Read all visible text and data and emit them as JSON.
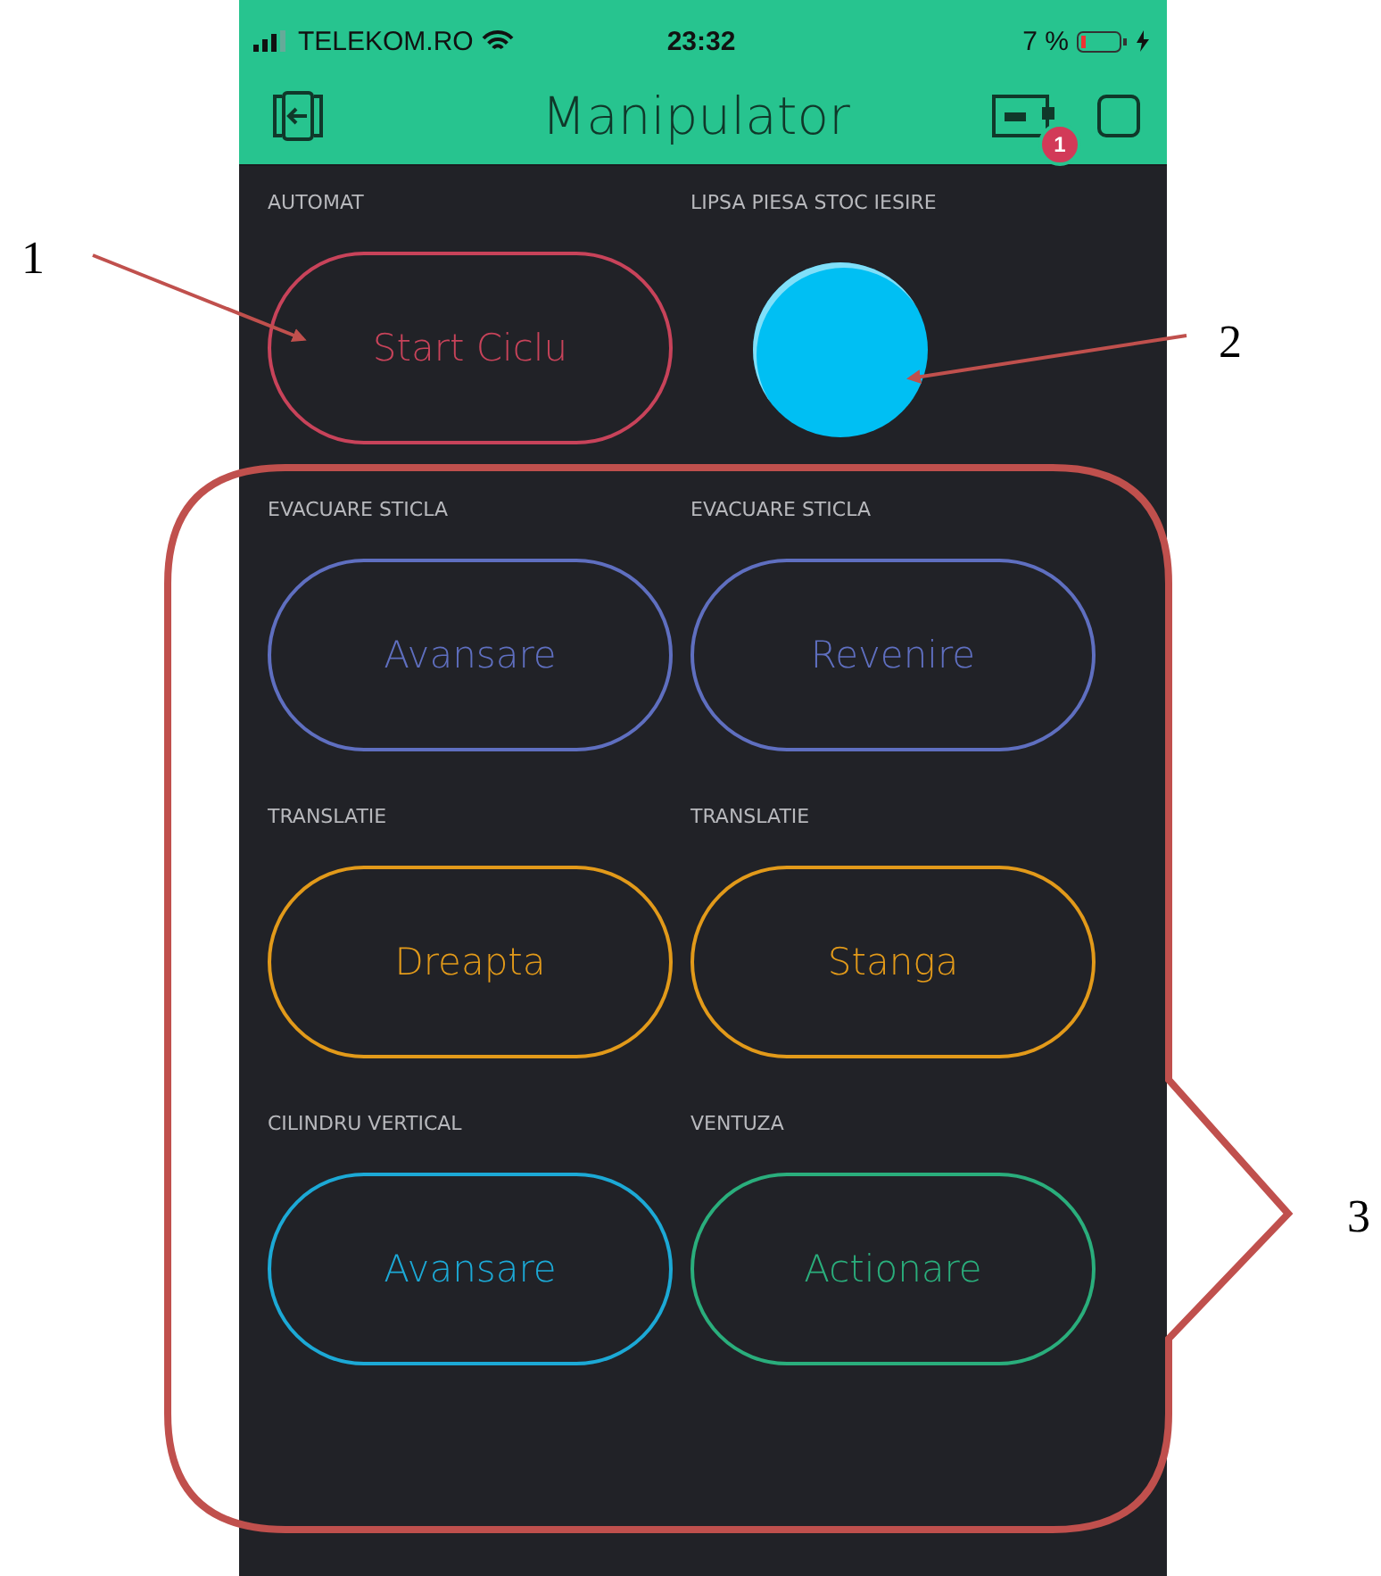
{
  "status_bar": {
    "carrier": "TELEKOM.RO",
    "time": "23:32",
    "battery": "7 %"
  },
  "header": {
    "title": "Manipulator",
    "badge": "1"
  },
  "widgets": [
    {
      "label": "AUTOMAT",
      "kind": "button",
      "text": "Start Ciclu",
      "color": "#c8435a"
    },
    {
      "label": "LIPSA PIESA STOC IESIRE",
      "kind": "led",
      "color": "#00bff3"
    },
    {
      "label": "EVACUARE STICLA",
      "kind": "button",
      "text": "Avansare",
      "color": "#5f6fc0"
    },
    {
      "label": "EVACUARE STICLA",
      "kind": "button",
      "text": "Revenire",
      "color": "#5f6fc0"
    },
    {
      "label": "TRANSLATIE",
      "kind": "button",
      "text": "Dreapta",
      "color": "#e29a1a"
    },
    {
      "label": "TRANSLATIE",
      "kind": "button",
      "text": "Stanga",
      "color": "#e29a1a"
    },
    {
      "label": "CILINDRU VERTICAL",
      "kind": "button",
      "text": "Avansare",
      "color": "#1ca9d6"
    },
    {
      "label": "VENTUZA",
      "kind": "button",
      "text": "Actionare",
      "color": "#2aae7c"
    }
  ],
  "annotations": [
    {
      "label": "1"
    },
    {
      "label": "2"
    },
    {
      "label": "3"
    }
  ]
}
